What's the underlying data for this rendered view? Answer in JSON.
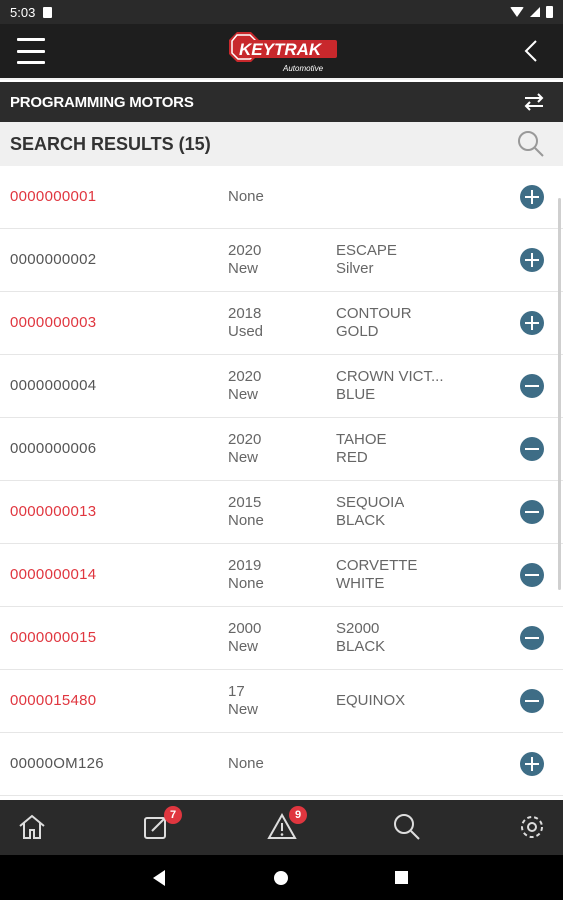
{
  "status_bar": {
    "time": "5:03"
  },
  "header": {
    "logo_main": "KEYTRAK",
    "logo_sub": "Automotive"
  },
  "section": {
    "title": "PROGRAMMING MOTORS"
  },
  "search": {
    "title": "SEARCH RESULTS (15)"
  },
  "colors": {
    "accent_red": "#e0363f",
    "action_blue": "#3e6d86",
    "header_dark": "#1e1e1e"
  },
  "results": [
    {
      "code": "0000000001",
      "highlight": true,
      "year": "None",
      "condition": "",
      "model": "",
      "color": "",
      "action": "add"
    },
    {
      "code": "0000000002",
      "highlight": false,
      "year": "2020",
      "condition": "New",
      "model": "ESCAPE",
      "color": "Silver",
      "action": "add"
    },
    {
      "code": "0000000003",
      "highlight": true,
      "year": "2018",
      "condition": "Used",
      "model": "CONTOUR",
      "color": "GOLD",
      "action": "add"
    },
    {
      "code": "0000000004",
      "highlight": false,
      "year": "2020",
      "condition": "New",
      "model": "CROWN VICT...",
      "color": "BLUE",
      "action": "remove"
    },
    {
      "code": "0000000006",
      "highlight": false,
      "year": "2020",
      "condition": "New",
      "model": "TAHOE",
      "color": "RED",
      "action": "remove"
    },
    {
      "code": "0000000013",
      "highlight": true,
      "year": "2015",
      "condition": "None",
      "model": "SEQUOIA",
      "color": "BLACK",
      "action": "remove"
    },
    {
      "code": "0000000014",
      "highlight": true,
      "year": "2019",
      "condition": "None",
      "model": "CORVETTE",
      "color": "WHITE",
      "action": "remove"
    },
    {
      "code": "0000000015",
      "highlight": true,
      "year": "2000",
      "condition": "New",
      "model": "S2000",
      "color": "BLACK",
      "action": "remove"
    },
    {
      "code": "0000015480",
      "highlight": true,
      "year": "17",
      "condition": "New",
      "model": "EQUINOX",
      "color": "",
      "action": "remove"
    },
    {
      "code": "00000OM126",
      "highlight": false,
      "year": "None",
      "condition": "",
      "model": "",
      "color": "",
      "action": "add"
    }
  ],
  "bottom_nav": {
    "items": [
      {
        "name": "home-icon",
        "badge": ""
      },
      {
        "name": "edit-note-icon",
        "badge": "7"
      },
      {
        "name": "alert-icon",
        "badge": "9"
      },
      {
        "name": "search-icon",
        "badge": ""
      },
      {
        "name": "settings-gear-icon",
        "badge": ""
      }
    ]
  }
}
